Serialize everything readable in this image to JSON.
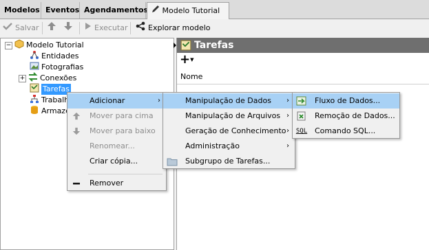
{
  "tabs": [
    {
      "label": "Modelos"
    },
    {
      "label": "Eventos"
    },
    {
      "label": "Agendamentos"
    },
    {
      "label": "Modelo Tutorial",
      "close": "✕"
    }
  ],
  "toolbar": {
    "save": "Salvar",
    "execute": "Executar",
    "explore": "Explorar modelo"
  },
  "tree": {
    "root": "Modelo Tutorial",
    "items": [
      "Entidades",
      "Fotografias",
      "Conexões",
      "Tarefas",
      "Trabalh",
      "Armazen"
    ]
  },
  "panel": {
    "title": "Tarefas",
    "add": "+",
    "column": "Nome"
  },
  "context_menu": {
    "items": [
      "Adicionar",
      "Mover para cima",
      "Mover para baixo",
      "Renomear...",
      "Criar cópia...",
      "Remover"
    ]
  },
  "submenu_add": {
    "items": [
      "Manipulação de Dados",
      "Manipulação de Arquivos",
      "Geração de Conhecimento",
      "Administração",
      "Subgrupo de Tarefas..."
    ]
  },
  "submenu_data": {
    "items": [
      "Fluxo de Dados...",
      "Remoção de Dados...",
      "Comando SQL..."
    ]
  },
  "colors": {
    "selection": "#3399ff",
    "menu_highlight": "#a8d1f5",
    "header_bg": "#6f6f6f"
  }
}
